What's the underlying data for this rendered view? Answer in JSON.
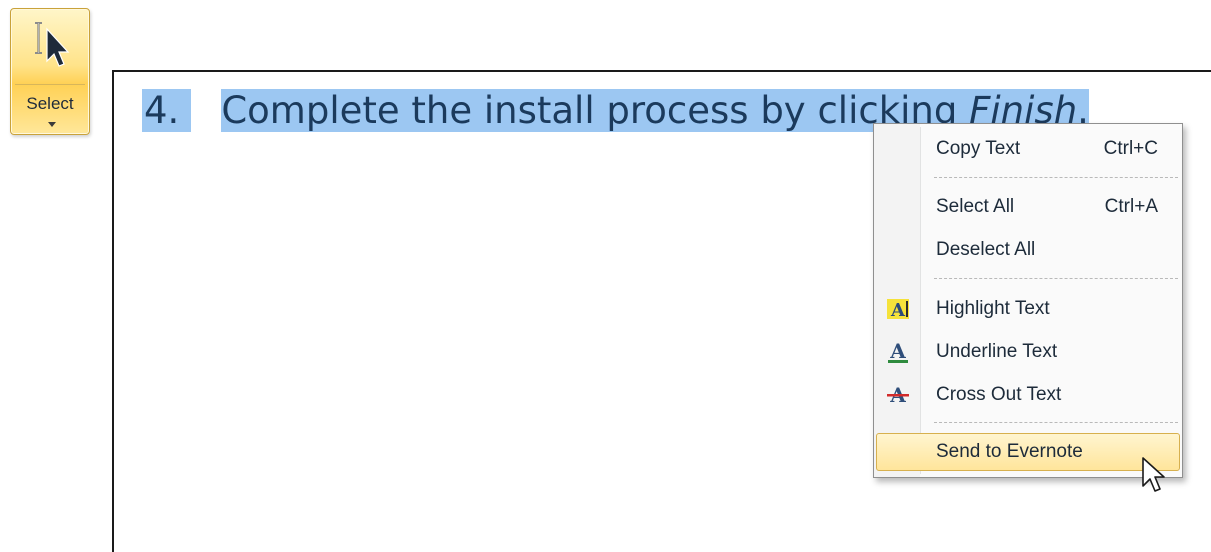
{
  "select_button": {
    "label": "Select",
    "icon": "text-select-cursor-icon"
  },
  "document": {
    "line_number": "4.",
    "line_text": "Complete the install process by clicking ",
    "line_emphasis": "Finish",
    "line_end": "."
  },
  "context_menu": {
    "copy_text": "Copy Text",
    "copy_shortcut": "Ctrl+C",
    "select_all": "Select All",
    "select_all_shortcut": "Ctrl+A",
    "deselect_all": "Deselect All",
    "highlight_text": "Highlight Text",
    "underline_text": "Underline Text",
    "cross_out_text": "Cross Out Text",
    "send_to_evernote": "Send to Evernote"
  },
  "colors": {
    "selection": "#9cc7f2",
    "menu_hover": "#ffe59b",
    "button_bg": "#ffd155"
  }
}
